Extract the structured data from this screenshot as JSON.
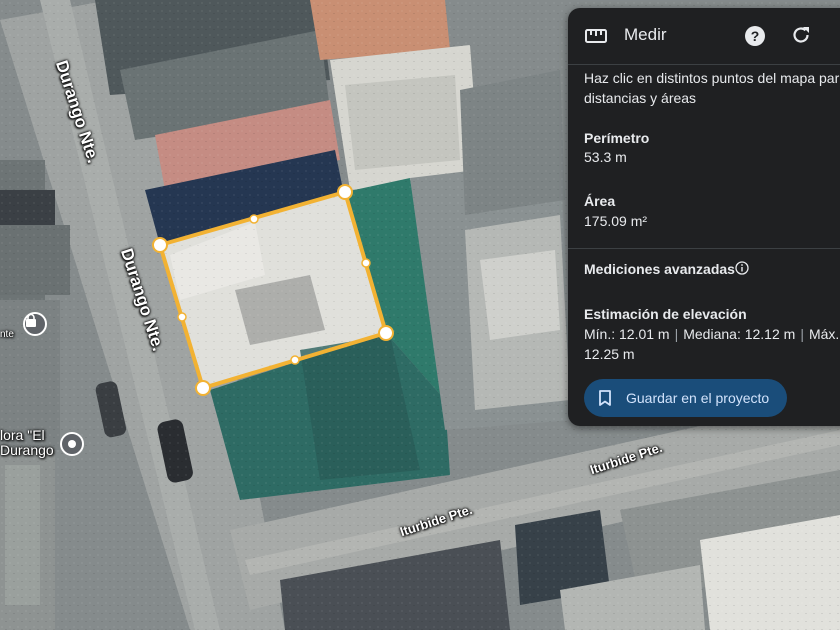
{
  "map": {
    "streets": {
      "durango_top": "Durango Nte.",
      "durango_mid": "Durango Nte.",
      "iturbide_right": "Iturbide Pte.",
      "iturbide_bottom": "Iturbide Pte."
    },
    "poi": {
      "line1": "lora \"El",
      "line2": "Durango",
      "partial_left": "nte"
    }
  },
  "panel": {
    "title": "Medir",
    "intro_line1": "Haz clic en distintos puntos del mapa par",
    "intro_line2": "distancias y áreas",
    "perimeter_label": "Perímetro",
    "perimeter_value": "53.3 m",
    "area_label": "Área",
    "area_value": "175.09 m²",
    "advanced_label": "Mediciones avanzadas",
    "elevation_title": "Estimación de elevación",
    "elevation_min": "Mín.: 12.01 m",
    "elevation_median": "Mediana: 12.12 m",
    "elevation_max": "Máx.:",
    "elevation_max_value": "12.25 m",
    "save_label": "Guardar en el proyecto"
  },
  "colors": {
    "measure_line": "#f2b233",
    "panel_bg": "#1f2022",
    "button_bg": "#1a4d7a",
    "button_text": "#d2e3fc"
  },
  "icons": [
    "ruler-icon",
    "help-icon",
    "refresh-icon",
    "info-icon",
    "bookmark-icon",
    "lock-icon",
    "place-pin-icon"
  ]
}
